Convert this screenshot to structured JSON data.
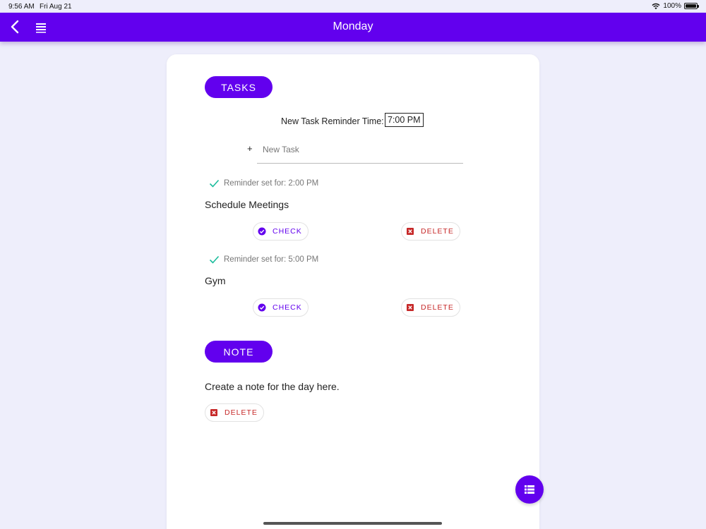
{
  "status_bar": {
    "time": "9:56 AM",
    "date": "Fri Aug 21",
    "battery": "100%"
  },
  "app_bar": {
    "title": "Monday"
  },
  "tasks_section": {
    "header_label": "TASKS",
    "reminder_label": "New Task Reminder Time:",
    "reminder_time": "7:00 PM",
    "add_icon": "+",
    "new_task_placeholder": "New Task",
    "items": [
      {
        "reminder": "Reminder set for: 2:00 PM",
        "name": "Schedule Meetings",
        "check_label": "CHECK",
        "delete_label": "DELETE"
      },
      {
        "reminder": "Reminder set for: 5:00 PM",
        "name": "Gym",
        "check_label": "CHECK",
        "delete_label": "DELETE"
      }
    ]
  },
  "note_section": {
    "header_label": "NOTE",
    "text": "Create a note for the day here.",
    "delete_label": "DELETE"
  },
  "icons": {
    "back": "chevron-left-icon",
    "menu": "hamburger-menu-icon",
    "reminder_check": "checkmark-icon",
    "check_chip": "check-circle-icon",
    "delete_chip": "close-box-icon",
    "fab": "list-icon",
    "wifi": "wifi-icon",
    "battery": "battery-icon"
  },
  "colors": {
    "primary": "#6200ee",
    "background": "#eeeefb",
    "danger": "#c62828",
    "success_check": "#1abc9c"
  }
}
